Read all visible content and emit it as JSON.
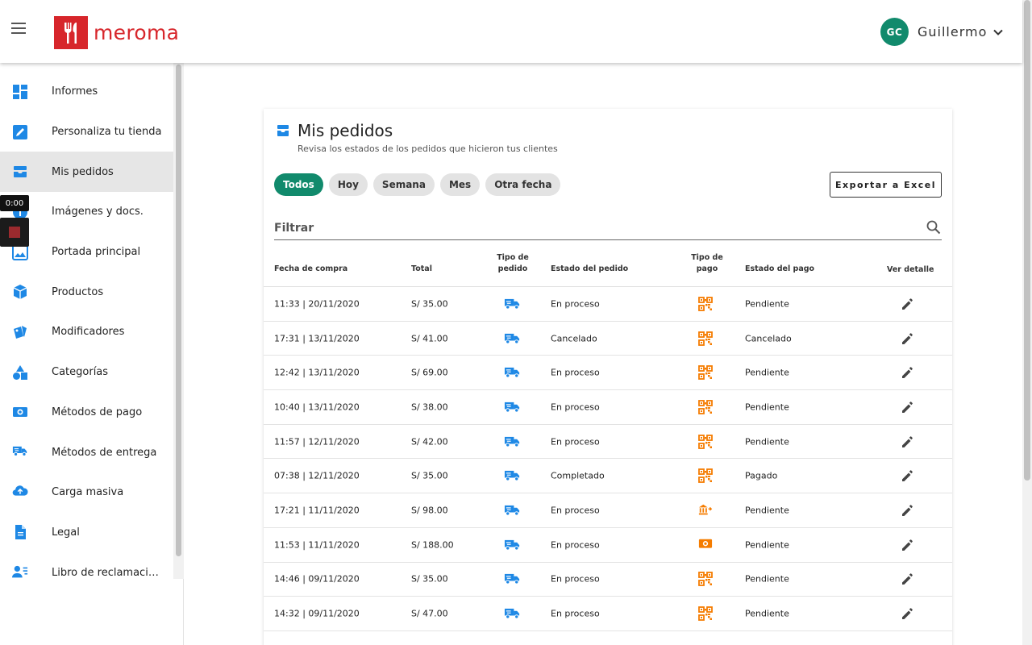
{
  "header": {
    "brand": "meroma",
    "user_initials": "GC",
    "user_name": "Guillermo"
  },
  "sidebar": {
    "items": [
      {
        "label": "Informes",
        "icon": "dashboard-icon"
      },
      {
        "label": "Personaliza tu tienda",
        "icon": "edit-square-icon"
      },
      {
        "label": "Mis pedidos",
        "icon": "inbox-tray-icon",
        "active": true
      },
      {
        "label": "Imágenes y docs.",
        "icon": "info-icon"
      },
      {
        "label": "Portada principal",
        "icon": "image-icon"
      },
      {
        "label": "Productos",
        "icon": "cube-icon"
      },
      {
        "label": "Modificadores",
        "icon": "tags-icon"
      },
      {
        "label": "Categorías",
        "icon": "shapes-icon"
      },
      {
        "label": "Métodos de pago",
        "icon": "cash-icon"
      },
      {
        "label": "Métodos de entrega",
        "icon": "delivery-truck-icon"
      },
      {
        "label": "Carga masiva",
        "icon": "cloud-upload-icon"
      },
      {
        "label": "Legal",
        "icon": "document-icon"
      },
      {
        "label": "Libro de reclamaciones",
        "icon": "person-list-icon"
      }
    ]
  },
  "video_overlay": {
    "time": "0:00"
  },
  "main": {
    "title": "Mis pedidos",
    "subtitle": "Revisa los estados de los pedidos que hicieron tus clientes",
    "chips": [
      "Todos",
      "Hoy",
      "Semana",
      "Mes",
      "Otra fecha"
    ],
    "active_chip": "Todos",
    "export_label": "Exportar a Excel",
    "filter_placeholder": "Filtrar",
    "columns": {
      "fecha": "Fecha de compra",
      "total": "Total",
      "tipo_pedido": "Tipo de pedido",
      "estado_pedido": "Estado del pedido",
      "tipo_pago": "Tipo de pago",
      "estado_pago": "Estado del pago",
      "detalle": "Ver detalle"
    },
    "orders": [
      {
        "fecha": "11:33 | 20/11/2020",
        "total": "S/ 35.00",
        "tipo_pedido": "delivery-truck-icon",
        "estado": "En proceso",
        "tipo_pago": "qr-code-icon",
        "estado_pago": "Pendiente"
      },
      {
        "fecha": "17:31 | 13/11/2020",
        "total": "S/ 41.00",
        "tipo_pedido": "delivery-truck-icon",
        "estado": "Cancelado",
        "tipo_pago": "qr-code-icon",
        "estado_pago": "Cancelado"
      },
      {
        "fecha": "12:42 | 13/11/2020",
        "total": "S/ 69.00",
        "tipo_pedido": "delivery-truck-icon",
        "estado": "En proceso",
        "tipo_pago": "qr-code-icon",
        "estado_pago": "Pendiente"
      },
      {
        "fecha": "10:40 | 13/11/2020",
        "total": "S/ 38.00",
        "tipo_pedido": "delivery-truck-icon",
        "estado": "En proceso",
        "tipo_pago": "qr-code-icon",
        "estado_pago": "Pendiente"
      },
      {
        "fecha": "11:57 | 12/11/2020",
        "total": "S/ 42.00",
        "tipo_pedido": "delivery-truck-icon",
        "estado": "En proceso",
        "tipo_pago": "qr-code-icon",
        "estado_pago": "Pendiente"
      },
      {
        "fecha": "07:38 | 12/11/2020",
        "total": "S/ 35.00",
        "tipo_pedido": "delivery-truck-icon",
        "estado": "Completado",
        "tipo_pago": "qr-code-icon",
        "estado_pago": "Pagado"
      },
      {
        "fecha": "17:21 | 11/11/2020",
        "total": "S/ 98.00",
        "tipo_pedido": "delivery-truck-icon",
        "estado": "En proceso",
        "tipo_pago": "bank-transfer-icon",
        "estado_pago": "Pendiente"
      },
      {
        "fecha": "11:53 | 11/11/2020",
        "total": "S/ 188.00",
        "tipo_pedido": "delivery-truck-icon",
        "estado": "En proceso",
        "tipo_pago": "cash-icon",
        "estado_pago": "Pendiente"
      },
      {
        "fecha": "14:46 | 09/11/2020",
        "total": "S/ 35.00",
        "tipo_pedido": "delivery-truck-icon",
        "estado": "En proceso",
        "tipo_pago": "qr-code-icon",
        "estado_pago": "Pendiente"
      },
      {
        "fecha": "14:32 | 09/11/2020",
        "total": "S/ 47.00",
        "tipo_pedido": "delivery-truck-icon",
        "estado": "En proceso",
        "tipo_pago": "qr-code-icon",
        "estado_pago": "Pendiente"
      }
    ]
  },
  "colors": {
    "brand_red": "#d7262b",
    "accent_green": "#118a6c",
    "icon_blue": "#1e88e5",
    "icon_orange": "#f57c00"
  }
}
